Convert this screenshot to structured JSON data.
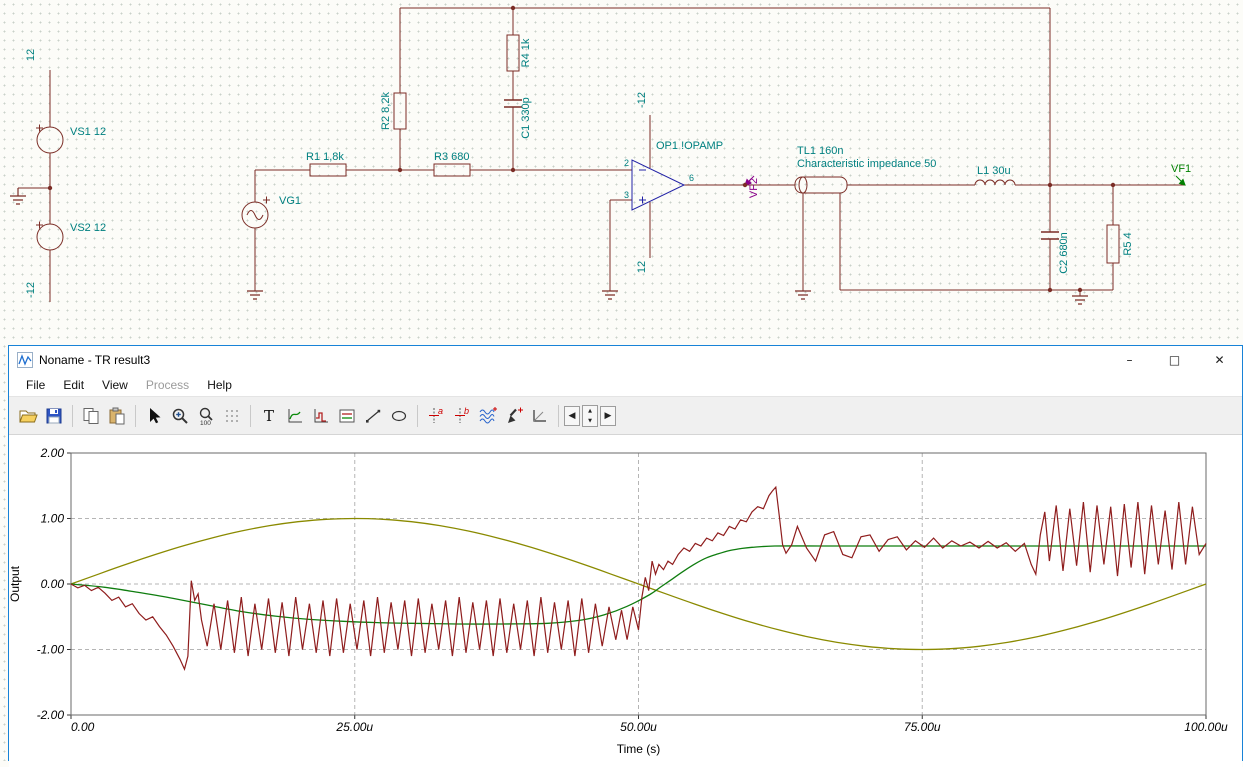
{
  "schematic": {
    "labels": {
      "rail_top": "12",
      "rail_bottom": "-12",
      "vs1": "VS1 12",
      "vs2": "VS2 12",
      "vg1": "VG1",
      "r1": "R1 1,8k",
      "r2": "R2 8,2k",
      "r3": "R3 680",
      "r4": "R4 1k",
      "c1": "C1 330p",
      "opamp": "OP1 !OPAMP",
      "opamp_top": "-12",
      "opamp_bottom": "12",
      "pin2": "2",
      "pin3": "3",
      "pin6": "6",
      "vf2": "VF2",
      "tl1": "TL1 160n",
      "tl1_desc": "Characteristic impedance 50",
      "l1": "L1 30u",
      "c2": "C2 680n",
      "r5": "R5 4",
      "vf1": "VF1"
    },
    "colors": {
      "wire": "#7b2d26",
      "label": "#008080",
      "opamp": "#2222a6",
      "vf1": "#008000",
      "vf2": "#8a008a"
    }
  },
  "window": {
    "title": "Noname - TR result3",
    "controls": {
      "minimize_glyph": "–",
      "maximize_glyph": "□",
      "close_glyph": "✕"
    }
  },
  "menu": {
    "items": [
      "File",
      "Edit",
      "View",
      "Process",
      "Help"
    ],
    "disabled_item": "Process"
  },
  "toolbar": {
    "text_tool_glyph": "T",
    "cursor_a_glyph": "a",
    "cursor_b_glyph": "b",
    "zoom_percent": "100",
    "nav_left_glyph": "◀",
    "nav_right_glyph": "▶",
    "spin_up_glyph": "▲",
    "spin_down_glyph": "▼",
    "buttons": [
      "open",
      "save",
      "copy",
      "paste",
      "select-cursor",
      "zoom-in",
      "zoom-100",
      "grid",
      "text-tool",
      "diagram-curve-tool",
      "diagram-step-tool",
      "legend-tool",
      "line-tool",
      "ellipse-tool",
      "cursor-a",
      "cursor-b",
      "signal-waves-tool",
      "pen-tool",
      "corner-tool",
      "prev-curve",
      "curve-spinner",
      "next-curve"
    ]
  },
  "chart_data": {
    "type": "line",
    "title": "",
    "xlabel": "Time (s)",
    "ylabel": "Output",
    "grid": "dashed",
    "xlim_u": [
      0,
      100
    ],
    "ylim": [
      -2,
      2
    ],
    "x_ticks_u": [
      0,
      25,
      50,
      75,
      100
    ],
    "x_tick_labels": [
      "0.00",
      "25.00u",
      "50.00u",
      "75.00u",
      "100.00u"
    ],
    "y_ticks": [
      -2,
      -1,
      0,
      1,
      2
    ],
    "y_tick_labels": [
      "-2.00",
      "-1.00",
      "0.00",
      "1.00",
      "2.00"
    ],
    "series": [
      {
        "name": "olive-sine",
        "color": "#8a8a00",
        "smooth": true,
        "points": [
          [
            0,
            0
          ],
          [
            2.5,
            0.156
          ],
          [
            5,
            0.309
          ],
          [
            7.5,
            0.454
          ],
          [
            10,
            0.588
          ],
          [
            12.5,
            0.707
          ],
          [
            15,
            0.809
          ],
          [
            17.5,
            0.891
          ],
          [
            20,
            0.951
          ],
          [
            22.5,
            0.988
          ],
          [
            25,
            1
          ],
          [
            27.5,
            0.988
          ],
          [
            30,
            0.951
          ],
          [
            32.5,
            0.891
          ],
          [
            35,
            0.809
          ],
          [
            37.5,
            0.707
          ],
          [
            40,
            0.588
          ],
          [
            42.5,
            0.454
          ],
          [
            45,
            0.309
          ],
          [
            47.5,
            0.156
          ],
          [
            50,
            0
          ],
          [
            52.5,
            -0.156
          ],
          [
            55,
            -0.309
          ],
          [
            57.5,
            -0.454
          ],
          [
            60,
            -0.588
          ],
          [
            62.5,
            -0.707
          ],
          [
            65,
            -0.809
          ],
          [
            67.5,
            -0.891
          ],
          [
            70,
            -0.951
          ],
          [
            72.5,
            -0.988
          ],
          [
            75,
            -1
          ],
          [
            77.5,
            -0.988
          ],
          [
            80,
            -0.951
          ],
          [
            82.5,
            -0.891
          ],
          [
            85,
            -0.809
          ],
          [
            87.5,
            -0.707
          ],
          [
            90,
            -0.588
          ],
          [
            92.5,
            -0.454
          ],
          [
            95,
            -0.309
          ],
          [
            97.5,
            -0.156
          ],
          [
            100,
            0
          ]
        ]
      },
      {
        "name": "green-response",
        "color": "#0f7d0f",
        "smooth": true,
        "points": [
          [
            0,
            0
          ],
          [
            3,
            -0.05
          ],
          [
            6,
            -0.13
          ],
          [
            9,
            -0.22
          ],
          [
            12,
            -0.32
          ],
          [
            15,
            -0.42
          ],
          [
            18,
            -0.49
          ],
          [
            21,
            -0.54
          ],
          [
            24,
            -0.57
          ],
          [
            27,
            -0.59
          ],
          [
            30,
            -0.6
          ],
          [
            34,
            -0.61
          ],
          [
            38,
            -0.61
          ],
          [
            42,
            -0.6
          ],
          [
            45,
            -0.55
          ],
          [
            47,
            -0.47
          ],
          [
            49,
            -0.34
          ],
          [
            51,
            -0.16
          ],
          [
            52,
            -0.04
          ],
          [
            53,
            0.08
          ],
          [
            54,
            0.2
          ],
          [
            55,
            0.31
          ],
          [
            56,
            0.4
          ],
          [
            57,
            0.46
          ],
          [
            58,
            0.51
          ],
          [
            59,
            0.54
          ],
          [
            60,
            0.56
          ],
          [
            62,
            0.58
          ],
          [
            66,
            0.58
          ],
          [
            70,
            0.58
          ],
          [
            75,
            0.58
          ],
          [
            80,
            0.58
          ],
          [
            85,
            0.58
          ],
          [
            90,
            0.58
          ],
          [
            95,
            0.58
          ],
          [
            100,
            0.58
          ]
        ]
      },
      {
        "name": "darkred-output",
        "color": "#8f1d1d",
        "smooth": false,
        "points": [
          [
            0,
            0
          ],
          [
            0.6,
            -0.06
          ],
          [
            1.2,
            -0.02
          ],
          [
            1.8,
            -0.1
          ],
          [
            2.4,
            -0.05
          ],
          [
            3,
            -0.14
          ],
          [
            3.6,
            -0.25
          ],
          [
            4.2,
            -0.2
          ],
          [
            4.8,
            -0.35
          ],
          [
            5.4,
            -0.3
          ],
          [
            6,
            -0.45
          ],
          [
            6.6,
            -0.55
          ],
          [
            7.2,
            -0.5
          ],
          [
            7.8,
            -0.65
          ],
          [
            8.4,
            -0.78
          ],
          [
            9,
            -0.95
          ],
          [
            9.6,
            -1.15
          ],
          [
            10,
            -1.3
          ],
          [
            10.3,
            -1.1
          ],
          [
            10.6,
            0.05
          ],
          [
            10.9,
            -0.25
          ],
          [
            11.2,
            -0.15
          ],
          [
            11.5,
            -0.55
          ],
          [
            12,
            -0.95
          ],
          [
            12.6,
            -0.3
          ],
          [
            13.2,
            -1
          ],
          [
            13.8,
            -0.25
          ],
          [
            14.4,
            -1.05
          ],
          [
            15,
            -0.2
          ],
          [
            15.6,
            -1.1
          ],
          [
            16.2,
            -0.3
          ],
          [
            16.8,
            -1
          ],
          [
            17.4,
            -0.22
          ],
          [
            18,
            -1.05
          ],
          [
            18.6,
            -0.28
          ],
          [
            19.2,
            -1.1
          ],
          [
            19.8,
            -0.2
          ],
          [
            20.4,
            -1
          ],
          [
            21,
            -0.3
          ],
          [
            21.6,
            -1.05
          ],
          [
            22.2,
            -0.25
          ],
          [
            22.8,
            -1.1
          ],
          [
            23.4,
            -0.22
          ],
          [
            24,
            -1.05
          ],
          [
            24.6,
            -0.3
          ],
          [
            25.2,
            -1
          ],
          [
            25.8,
            -0.25
          ],
          [
            26.4,
            -1.1
          ],
          [
            27,
            -0.2
          ],
          [
            27.6,
            -1.05
          ],
          [
            28.2,
            -0.28
          ],
          [
            28.8,
            -1
          ],
          [
            29.4,
            -0.25
          ],
          [
            30,
            -1.1
          ],
          [
            30.6,
            -0.22
          ],
          [
            31.2,
            -1.05
          ],
          [
            31.8,
            -0.3
          ],
          [
            32.4,
            -1
          ],
          [
            33,
            -0.25
          ],
          [
            33.6,
            -1.1
          ],
          [
            34.2,
            -0.2
          ],
          [
            34.8,
            -1.05
          ],
          [
            35.4,
            -0.28
          ],
          [
            36,
            -1
          ],
          [
            36.6,
            -0.25
          ],
          [
            37.2,
            -1.1
          ],
          [
            37.8,
            -0.22
          ],
          [
            38.4,
            -1.05
          ],
          [
            39,
            -0.3
          ],
          [
            39.6,
            -1
          ],
          [
            40.2,
            -0.25
          ],
          [
            40.8,
            -1.1
          ],
          [
            41.4,
            -0.2
          ],
          [
            42,
            -1.05
          ],
          [
            42.6,
            -0.28
          ],
          [
            43.2,
            -1
          ],
          [
            43.8,
            -0.25
          ],
          [
            44.4,
            -1.1
          ],
          [
            45,
            -0.22
          ],
          [
            45.6,
            -1.05
          ],
          [
            46.2,
            -0.3
          ],
          [
            46.8,
            -0.95
          ],
          [
            47.4,
            -0.35
          ],
          [
            48,
            -0.85
          ],
          [
            48.5,
            -0.4
          ],
          [
            49,
            -0.85
          ],
          [
            49.5,
            -0.35
          ],
          [
            50,
            -0.7
          ],
          [
            50.3,
            -0.2
          ],
          [
            50.6,
            0.1
          ],
          [
            50.9,
            -0.1
          ],
          [
            51.2,
            0.35
          ],
          [
            51.5,
            0.15
          ],
          [
            51.8,
            0.3
          ],
          [
            52.2,
            0.22
          ],
          [
            52.6,
            0.35
          ],
          [
            53,
            0.3
          ],
          [
            53.5,
            0.45
          ],
          [
            54,
            0.55
          ],
          [
            54.5,
            0.5
          ],
          [
            55,
            0.62
          ],
          [
            55.5,
            0.58
          ],
          [
            56,
            0.7
          ],
          [
            56.5,
            0.66
          ],
          [
            57,
            0.78
          ],
          [
            57.5,
            0.74
          ],
          [
            58,
            0.88
          ],
          [
            58.5,
            0.84
          ],
          [
            59,
            0.98
          ],
          [
            59.5,
            0.95
          ],
          [
            60,
            1.1
          ],
          [
            60.5,
            1.18
          ],
          [
            61,
            1.15
          ],
          [
            61.5,
            1.35
          ],
          [
            61.8,
            1.42
          ],
          [
            62.1,
            1.48
          ],
          [
            62.4,
            1.05
          ],
          [
            62.7,
            0.6
          ],
          [
            63,
            0.47
          ],
          [
            63.5,
            0.6
          ],
          [
            64,
            0.88
          ],
          [
            64.8,
            0.55
          ],
          [
            65.6,
            0.35
          ],
          [
            66.4,
            0.75
          ],
          [
            67.2,
            0.8
          ],
          [
            68,
            0.45
          ],
          [
            68.8,
            0.4
          ],
          [
            69.6,
            0.72
          ],
          [
            70.4,
            0.75
          ],
          [
            71.2,
            0.5
          ],
          [
            72,
            0.68
          ],
          [
            72.8,
            0.72
          ],
          [
            73.6,
            0.52
          ],
          [
            74.4,
            0.66
          ],
          [
            75.2,
            0.56
          ],
          [
            76,
            0.7
          ],
          [
            76.8,
            0.55
          ],
          [
            77.6,
            0.66
          ],
          [
            78.4,
            0.58
          ],
          [
            79.2,
            0.64
          ],
          [
            80,
            0.55
          ],
          [
            80.8,
            0.65
          ],
          [
            81.6,
            0.55
          ],
          [
            82.4,
            0.63
          ],
          [
            83.2,
            0.5
          ],
          [
            84,
            0.62
          ],
          [
            84.6,
            0.3
          ],
          [
            85,
            0.15
          ],
          [
            85.4,
            0.75
          ],
          [
            85.8,
            1.1
          ],
          [
            86.2,
            0.35
          ],
          [
            86.8,
            1.2
          ],
          [
            87.4,
            0.2
          ],
          [
            88,
            1.15
          ],
          [
            88.6,
            0.28
          ],
          [
            89.2,
            1.25
          ],
          [
            89.8,
            0.18
          ],
          [
            90.4,
            1.2
          ],
          [
            91,
            0.3
          ],
          [
            91.6,
            1.18
          ],
          [
            92.2,
            0.12
          ],
          [
            92.8,
            1.22
          ],
          [
            93.4,
            0.25
          ],
          [
            94,
            1.25
          ],
          [
            94.6,
            0.15
          ],
          [
            95.2,
            1.2
          ],
          [
            95.8,
            0.3
          ],
          [
            96.4,
            1.12
          ],
          [
            97,
            0.22
          ],
          [
            97.6,
            1.25
          ],
          [
            98.2,
            0.3
          ],
          [
            98.8,
            1.18
          ],
          [
            99.4,
            0.45
          ],
          [
            100,
            0.62
          ]
        ]
      }
    ]
  }
}
